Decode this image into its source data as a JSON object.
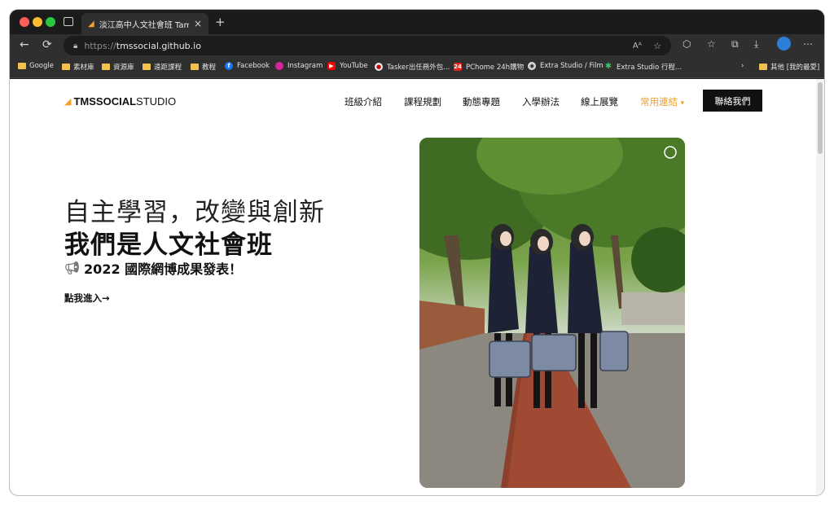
{
  "tab": {
    "title": "淡江高中人文社會班 Tamkang H",
    "close": "×",
    "new": "+"
  },
  "address": {
    "scheme": "https://",
    "host": "tmssocial.github.io"
  },
  "bookmarks": [
    {
      "label": "Google",
      "icon": "folder-icon"
    },
    {
      "label": "素材庫",
      "icon": "folder-icon"
    },
    {
      "label": "資源庫",
      "icon": "folder-icon"
    },
    {
      "label": "遠距課程",
      "icon": "folder-icon"
    },
    {
      "label": "教程",
      "icon": "folder-icon"
    },
    {
      "label": "Facebook",
      "icon": "facebook-icon"
    },
    {
      "label": "Instagram",
      "icon": "instagram-icon"
    },
    {
      "label": "YouTube",
      "icon": "youtube-icon"
    },
    {
      "label": "Tasker出任務外包...",
      "icon": "tasker-icon"
    },
    {
      "label": "PChome 24h購物",
      "icon": "pchome-icon"
    },
    {
      "label": "Extra Studio / Film",
      "icon": "extra-studio-icon"
    },
    {
      "label": "Extra Studio 行程...",
      "icon": "extra-studio-leaf-icon"
    },
    {
      "label": "其他 [我的最愛]",
      "icon": "folder-icon"
    }
  ],
  "site": {
    "logo_bold": "TMSSOCIAL",
    "logo_light": "STUDIO",
    "nav": [
      "班級介紹",
      "課程規劃",
      "動態專題",
      "入學辦法",
      "線上展覽",
      "常用連結"
    ],
    "dropdown_caret": "▾",
    "contact": "聯絡我們",
    "headline1": "自主學習，改變與創新",
    "headline2": "我們是人文社會班",
    "subheading": "2022 國際網博成果發表！",
    "cta": "點我進入→"
  },
  "colors": {
    "accent": "#f0a02b",
    "dark": "#111111"
  }
}
